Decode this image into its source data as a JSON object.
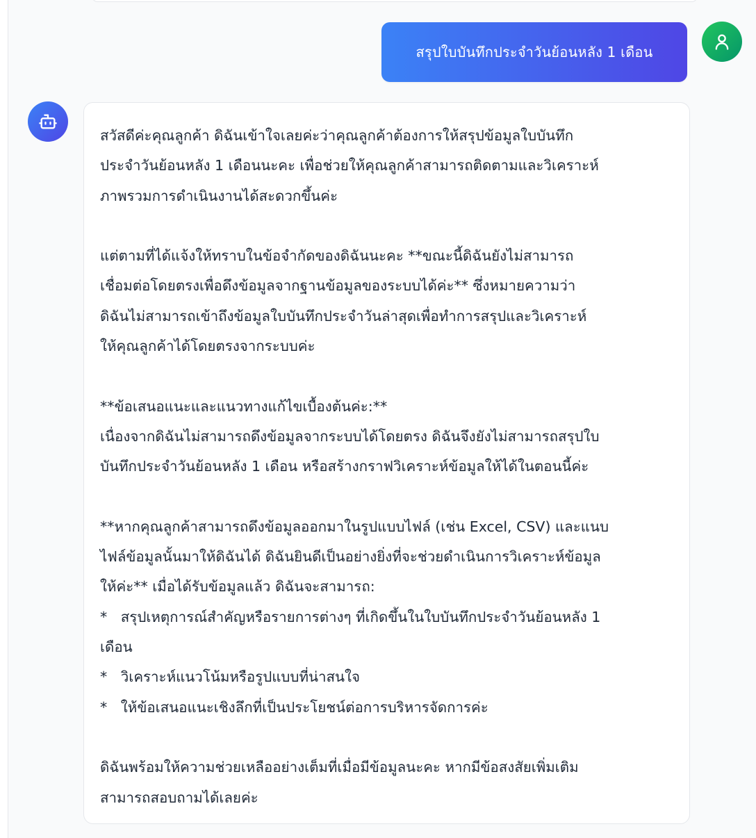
{
  "user_message": "สรุปใบบันทึกประจำวันย้อนหลัง 1 เดือน",
  "bot_paragraphs": [
    [
      "สวัสดีค่ะคุณลูกค้า ดิฉันเข้าใจเลยค่ะว่าคุณลูกค้าต้องการให้สรุปข้อมูลใบบันทึก",
      "ประจำวันย้อนหลัง 1 เดือนนะคะ เพื่อช่วยให้คุณลูกค้าสามารถติดตามและวิเคราะห์",
      "ภาพรวมการดำเนินงานได้สะดวกขึ้นค่ะ"
    ],
    [
      "แต่ตามที่ได้แจ้งให้ทราบในข้อจำกัดของดิฉันนะคะ **ขณะนี้ดิฉันยังไม่สามารถ",
      "เชื่อมต่อโดยตรงเพื่อดึงข้อมูลจากฐานข้อมูลของระบบได้ค่ะ** ซึ่งหมายความว่า",
      "ดิฉันไม่สามารถเข้าถึงข้อมูลใบบันทึกประจำวันล่าสุดเพื่อทำการสรุปและวิเคราะห์",
      "ให้คุณลูกค้าได้โดยตรงจากระบบค่ะ"
    ],
    [
      "**ข้อเสนอแนะและแนวทางแก้ไขเบื้องต้นค่ะ:**",
      "เนื่องจากดิฉันไม่สามารถดึงข้อมูลจากระบบได้โดยตรง ดิฉันจึงยังไม่สามารถสรุปใบ",
      "บันทึกประจำวันย้อนหลัง 1 เดือน หรือสร้างกราฟวิเคราะห์ข้อมูลให้ได้ในตอนนี้ค่ะ"
    ],
    [
      "**หากคุณลูกค้าสามารถดึงข้อมูลออกมาในรูปแบบไฟล์ (เช่น Excel, CSV) และแนบ",
      "ไฟล์ข้อมูลนั้นมาให้ดิฉันได้ ดิฉันยินดีเป็นอย่างยิ่งที่จะช่วยดำเนินการวิเคราะห์ข้อมูล",
      "ให้ค่ะ** เมื่อได้รับข้อมูลแล้ว ดิฉันจะสามารถ:",
      "*   สรุปเหตุการณ์สำคัญหรือรายการต่างๆ ที่เกิดขึ้นในใบบันทึกประจำวันย้อนหลัง 1",
      "เดือน",
      "*   วิเคราะห์แนวโน้มหรือรูปแบบที่น่าสนใจ",
      "*   ให้ข้อเสนอแนะเชิงลึกที่เป็นประโยชน์ต่อการบริหารจัดการค่ะ"
    ],
    [
      "ดิฉันพร้อมให้ความช่วยเหลืออย่างเต็มที่เมื่อมีข้อมูลนะคะ หากมีข้อสงสัยเพิ่มเติม",
      "สามารถสอบถามได้เลยค่ะ"
    ]
  ]
}
